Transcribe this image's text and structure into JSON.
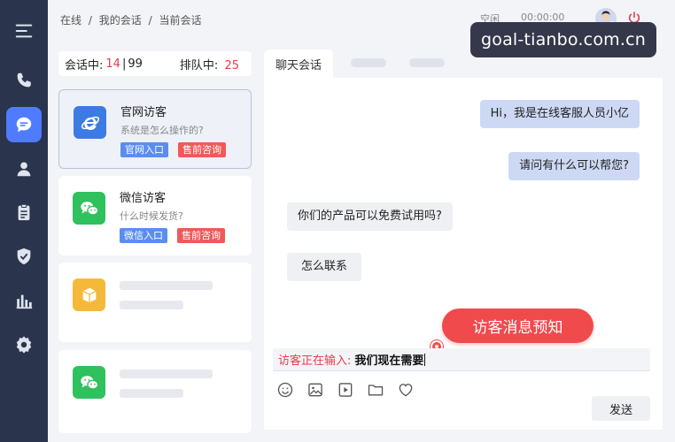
{
  "breadcrumb": [
    "在线",
    "/",
    "我的会话",
    "/",
    "当前会话"
  ],
  "status": {
    "idle": "空闲",
    "timer": "00:00:00"
  },
  "watermark": "goal-tianbo.com.cn",
  "stats": {
    "active_label": "会话中:",
    "active_count": "14",
    "separator": "|",
    "active_max": "99",
    "queue_label": "排队中:",
    "queue_count": "25"
  },
  "visitors": [
    {
      "name": "官网访客",
      "message": "系统是怎么操作的?",
      "source": "官网入口",
      "type": "售前咨询",
      "icon": "browser-e-icon"
    },
    {
      "name": "微信访客",
      "message": "什么时候发货?",
      "source": "微信入口",
      "type": "售前咨询",
      "icon": "wechat-icon"
    }
  ],
  "chat": {
    "tab": "聊天会话",
    "messages": [
      {
        "from": "agent",
        "text": "Hi，我是在线客服人员小亿"
      },
      {
        "from": "agent",
        "text": "请问有什么可以帮您?"
      },
      {
        "from": "visitor",
        "text": "你们的产品可以免费试用吗?"
      },
      {
        "from": "visitor",
        "text": "怎么联系"
      }
    ],
    "toast": "访客消息预知",
    "typing_label": "访客正在输入:",
    "typing_text": "我们现在需要",
    "send": "发送"
  },
  "colors": {
    "sidebar": "#2a344c",
    "accent": "#4f7bff",
    "red": "#e33e4b",
    "agent_bubble": "#cdd9f4"
  }
}
